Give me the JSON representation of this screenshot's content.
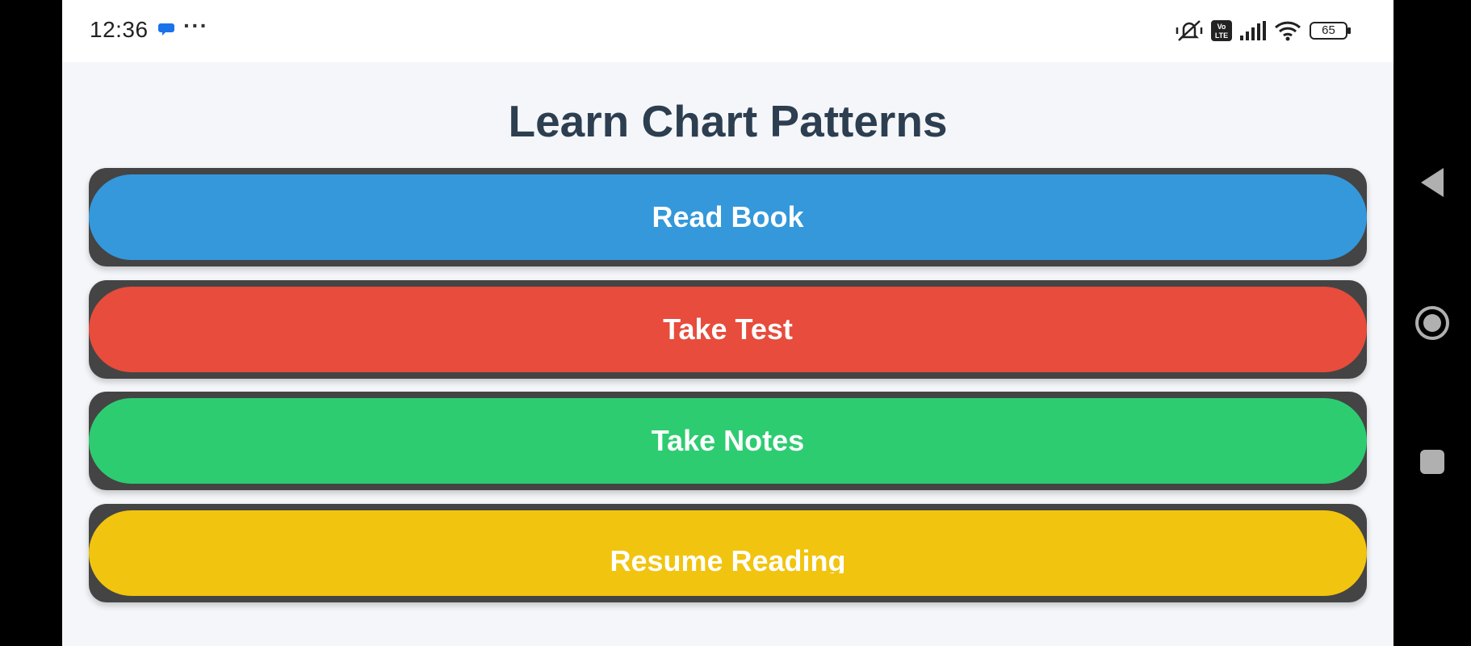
{
  "status_bar": {
    "time": "12:36",
    "more": "···",
    "battery": "65",
    "icons": [
      "chat-bubble-icon",
      "silent-bell-icon",
      "volte-icon",
      "signal-icon",
      "wifi-icon",
      "battery-icon"
    ]
  },
  "main": {
    "title": "Learn Chart Patterns",
    "buttons": [
      {
        "label": "Read Book",
        "color": "#3498db"
      },
      {
        "label": "Take Test",
        "color": "#e74c3c"
      },
      {
        "label": "Take Notes",
        "color": "#2ecc71"
      },
      {
        "label": "Resume Reading",
        "color": "#f1c40f"
      }
    ]
  },
  "nav_bar": {
    "icons": [
      "back-icon",
      "home-icon",
      "recent-apps-icon"
    ]
  },
  "colors": {
    "background": "#f4f6f9",
    "title": "#2c3e50",
    "button_frame": "#444444"
  }
}
